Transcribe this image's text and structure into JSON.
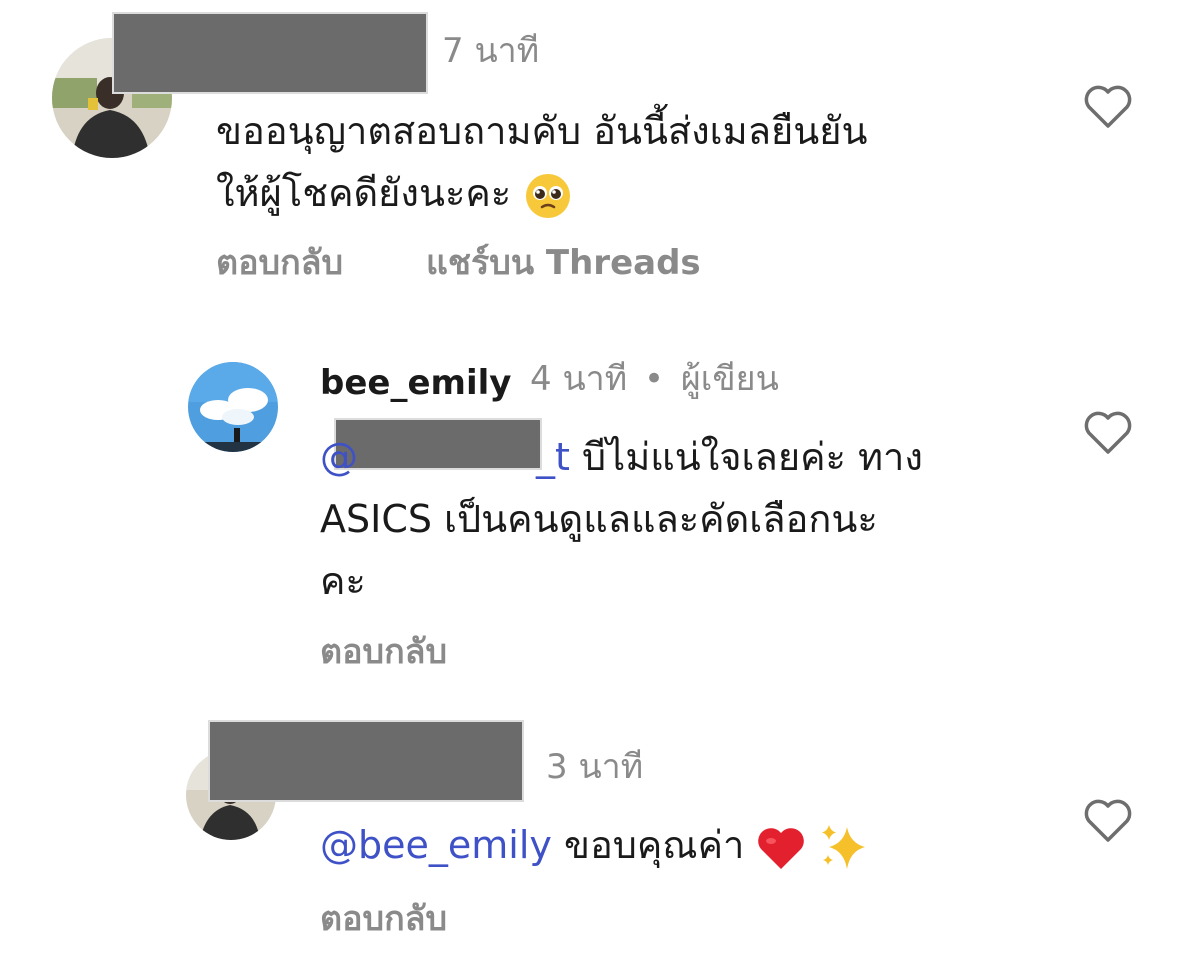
{
  "comments": [
    {
      "time": "7 นาที",
      "lines": [
        "ขออนุญาตสอบถามคับ อันนี้ส่งเมลยืนยัน",
        "ให้ผู้โชคดียังนะคะ"
      ],
      "emoji": "pleading-face",
      "actions": {
        "reply": "ตอบกลับ",
        "share": "แชร์บน Threads"
      },
      "like_icon": "heart-outline-icon"
    },
    {
      "username": "bee_emily",
      "time": "4 นาที",
      "separator": "•",
      "author_badge": "ผู้เขียน",
      "mention_suffix": "_t",
      "lines": [
        " บีไม่แน่ใจเลยค่ะ ทาง",
        "ASICS เป็นคนดูแลและคัดเลือกนะ",
        "คะ"
      ],
      "actions": {
        "reply": "ตอบกลับ"
      },
      "like_icon": "heart-outline-icon"
    },
    {
      "time": "3 นาที",
      "mention": "@bee_emily",
      "text": " ขอบคุณค่า ",
      "emoji": [
        "red-heart",
        "sparkles"
      ],
      "actions": {
        "reply": "ตอบกลับ"
      },
      "like_icon": "heart-outline-icon"
    }
  ],
  "colors": {
    "mention": "#3f51c7",
    "meta": "#8a8a8a",
    "redaction": "#6b6b6b"
  }
}
